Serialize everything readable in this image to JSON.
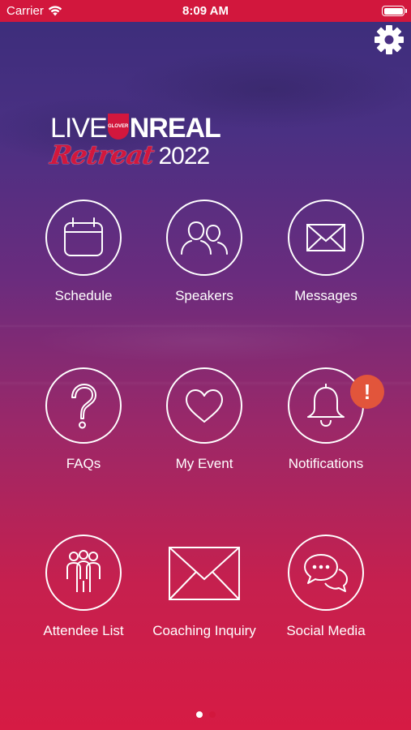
{
  "status_bar": {
    "carrier": "Carrier",
    "time": "8:09 AM"
  },
  "logo": {
    "live": "LIVE",
    "u_mark": "GLOVER",
    "unreal": "NREAL",
    "retreat": "Retreat",
    "year": "2022"
  },
  "grid": {
    "schedule": "Schedule",
    "speakers": "Speakers",
    "messages": "Messages",
    "faqs": "FAQs",
    "my_event": "My Event",
    "notifications": "Notifications",
    "notifications_badge": "!",
    "attendee_list": "Attendee List",
    "coaching_inquiry": "Coaching Inquiry",
    "social_media": "Social Media"
  },
  "pager": {
    "pages": 2,
    "current": 1
  },
  "colors": {
    "brand_red": "#d2173d",
    "gradient_top": "#3b2d7a",
    "gradient_bottom": "#d61b44",
    "alert_badge": "#e2553b"
  },
  "icons": [
    "wifi-icon",
    "battery-icon",
    "settings-gear-icon",
    "calendar-icon",
    "speakers-icon",
    "envelope-icon",
    "question-icon",
    "heart-icon",
    "bell-icon",
    "group-icon",
    "coaching-envelope-icon",
    "chat-bubbles-icon"
  ]
}
